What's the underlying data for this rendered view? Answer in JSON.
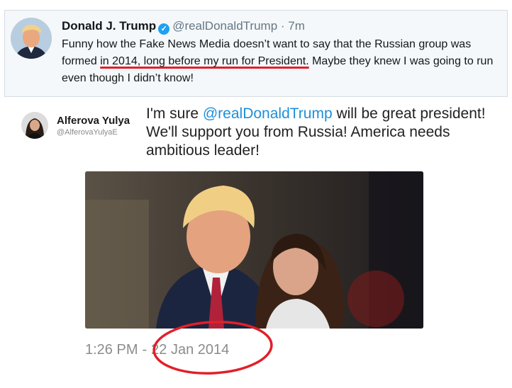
{
  "top_tweet": {
    "avatar_icon": "profile-photo-icon",
    "name": "Donald J. Trump",
    "verified_icon": "verified-badge-icon",
    "handle": "@realDonaldTrump",
    "separator": "·",
    "time": "7m",
    "text_before": "Funny how the Fake News Media doesn’t want to say that the Russian group was formed ",
    "text_highlight": "in 2014, long before my run for President.",
    "text_after": " Maybe they knew I was going to run even though I didn’t know!",
    "highlight_color": "#e0202a"
  },
  "embedded_tweet": {
    "avatar_icon": "profile-photo-icon",
    "name": "Alferova Yulya",
    "handle": "@AlferovaYulyaE",
    "text_before": "I'm sure ",
    "mention": "@realDonaldTrump",
    "text_after": " will be great president! We'll support you from Russia! America needs ambitious leader!",
    "photo_icon": "photo-of-two-people",
    "time": "1:26 PM",
    "time_separator": "-",
    "date": "22 Jan 2014",
    "annotation_color": "#e0202a",
    "mention_color": "#1d8fd9"
  }
}
